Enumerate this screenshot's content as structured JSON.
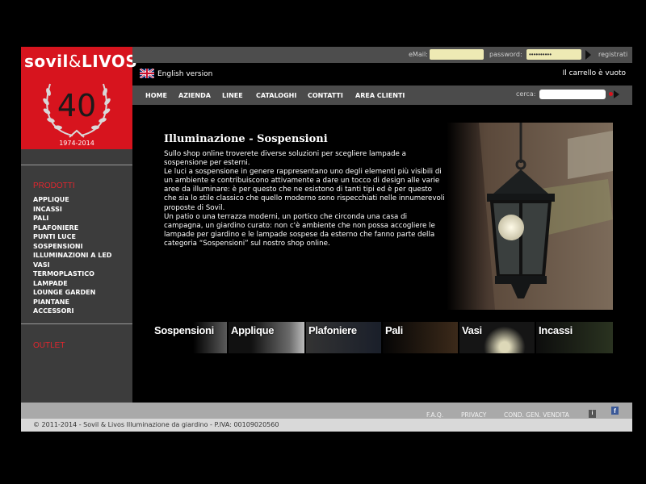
{
  "brand": {
    "name_left": "sovil",
    "amp": "&",
    "name_right": "LIVOS",
    "anniversary": "40",
    "years": "1974-2014"
  },
  "login": {
    "email_label": "eMail:",
    "email_value": "",
    "password_label": "password:",
    "password_value": "••••••••••",
    "register": "registrati"
  },
  "language": {
    "english": "English version",
    "cart": "Il carrello è vuoto"
  },
  "nav": {
    "items": [
      "HOME",
      "AZIENDA",
      "LINEE",
      "CATALOGHI",
      "CONTATTI",
      "AREA CLIENTI"
    ],
    "search_label": "cerca:"
  },
  "sidebar": {
    "heading": "PRODOTTI",
    "items": [
      "APPLIQUE",
      "INCASSI",
      "PALI",
      "PLAFONIERE",
      "PUNTI LUCE",
      "SOSPENSIONI",
      "ILLUMINAZIONI A LED",
      "VASI",
      "TERMOPLASTICO",
      "LAMPADE",
      "LOUNGE GARDEN",
      "PIANTANE",
      "ACCESSORI"
    ],
    "outlet": "OUTLET"
  },
  "content": {
    "title": "Illuminazione - Sospensioni",
    "paragraph1": "Sullo shop online troverete diverse soluzioni per scegliere lampade a sospensione per esterni.",
    "paragraph2": "Le luci a sospensione in genere rappresentano uno degli elementi più visibili di un ambiente e contribuiscono attivamente a dare un tocco di design alle varie aree da illuminare: è per questo che ne esistono di tanti tipi ed è per questo che sia lo stile classico che quello moderno sono rispecchiati nelle innumerevoli proposte di Sovil.",
    "paragraph3": "Un patio o una terrazza moderni, un portico che circonda una casa di campagna, un giardino curato: non c'è ambiente che non possa accogliere le lampade per giardino e le lampade sospese da esterno che fanno parte della categoria “Sospensioni” sul nostro shop online."
  },
  "categories": [
    "Sospensioni",
    "Applique",
    "Plafoniere",
    "Pali",
    "Vasi",
    "Incassi"
  ],
  "footer": {
    "links": [
      "F.A.Q.",
      "PRIVACY",
      "COND. GEN. VENDITA"
    ],
    "info_icon": "i",
    "facebook_icon": "f",
    "copyright": "© 2011-2014 - Sovil & Livos Illuminazione da giardino - P.IVA: 00109020560"
  },
  "colors": {
    "brand_red": "#d7141e",
    "sidebar_gray": "#3c3c3c",
    "nav_gray": "#4b4b4b",
    "input_yellow": "#eeeab4"
  }
}
